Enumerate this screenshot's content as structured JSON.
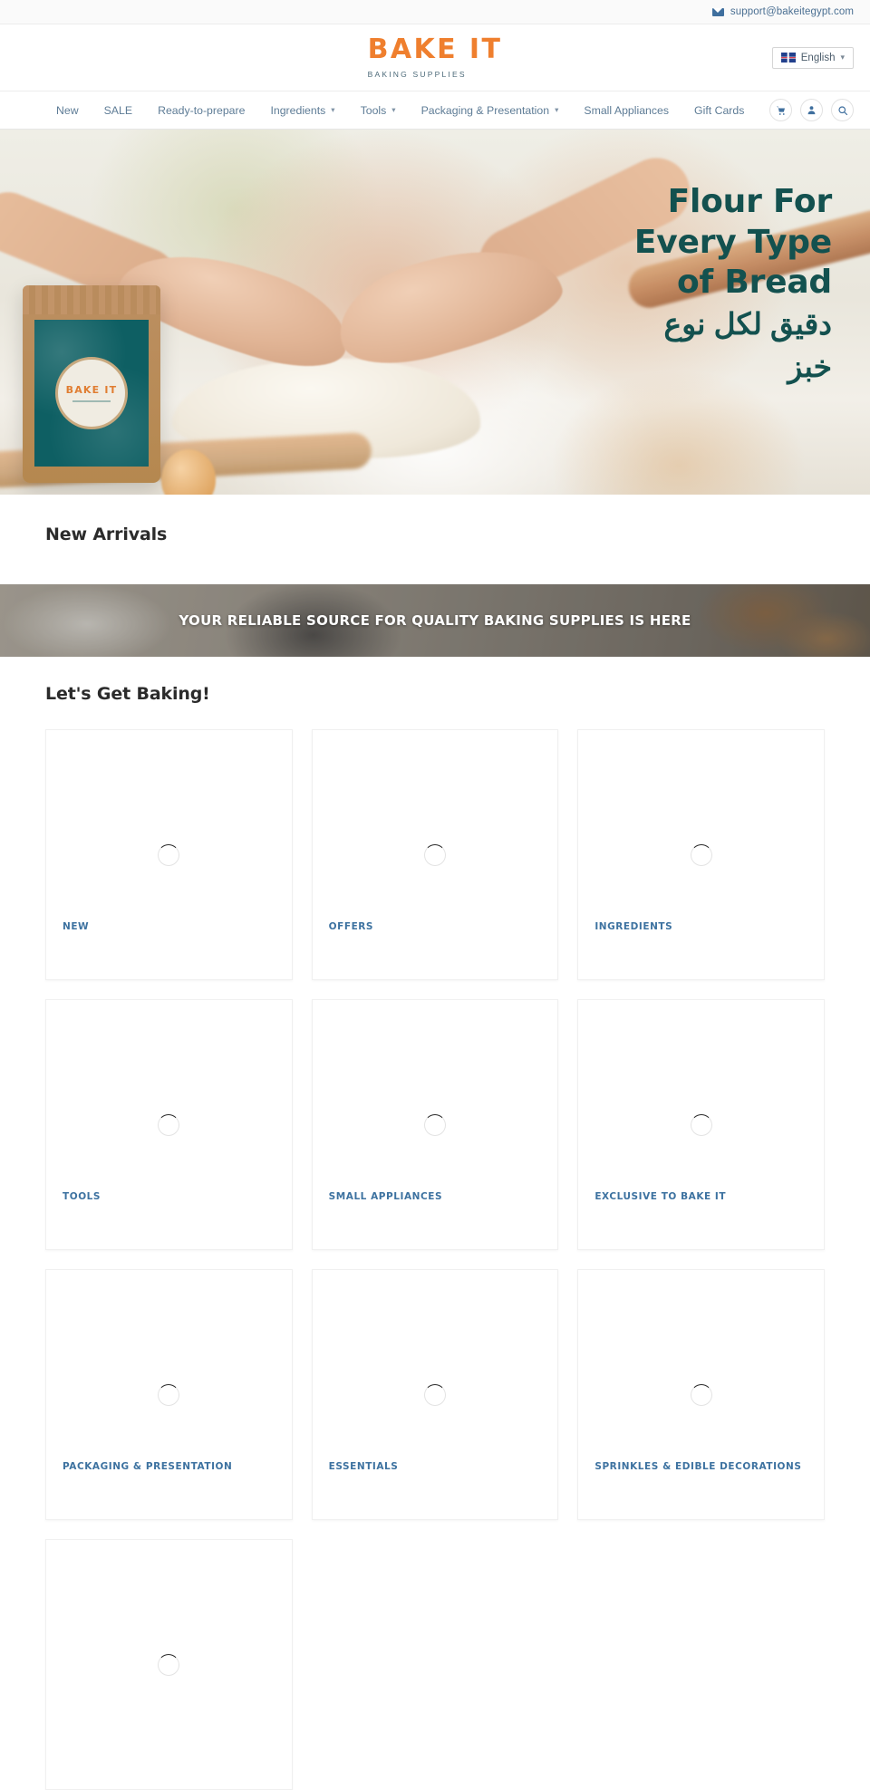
{
  "topbar": {
    "email": "support@bakeitegypt.com",
    "mail_icon": "envelope-icon"
  },
  "header": {
    "logo_main": "BAKE IT",
    "logo_sub": "BAKING SUPPLIES",
    "language": {
      "label": "English",
      "flag_icon": "uk-flag-icon",
      "caret_icon": "chevron-down-icon"
    }
  },
  "nav": {
    "items": [
      {
        "label": "New",
        "has_caret": false
      },
      {
        "label": "SALE",
        "has_caret": false
      },
      {
        "label": "Ready-to-prepare",
        "has_caret": false
      },
      {
        "label": "Ingredients",
        "has_caret": true
      },
      {
        "label": "Tools",
        "has_caret": true
      },
      {
        "label": "Packaging & Presentation",
        "has_caret": true
      },
      {
        "label": "Small Appliances",
        "has_caret": false
      },
      {
        "label": "Gift Cards",
        "has_caret": false
      }
    ],
    "caret": "⌄",
    "icons": [
      {
        "name": "cart-icon"
      },
      {
        "name": "account-icon"
      },
      {
        "name": "search-icon"
      }
    ]
  },
  "hero": {
    "line1": "Flour For",
    "line2": "Every Type",
    "line3": "of Bread",
    "arabic1": "دقيق لكل نوع",
    "arabic2": "خبز",
    "pouch_brand": "BAKE IT",
    "text_color": "#13514f"
  },
  "new_arrivals": {
    "title": "New Arrivals"
  },
  "promo": {
    "text": "YOUR RELIABLE SOURCE FOR QUALITY BAKING SUPPLIES IS HERE"
  },
  "baking": {
    "title": "Let's Get Baking!",
    "label_color": "#3d72a0",
    "cards": [
      {
        "label": "NEW"
      },
      {
        "label": "OFFERS"
      },
      {
        "label": "INGREDIENTS"
      },
      {
        "label": "TOOLS"
      },
      {
        "label": "SMALL APPLIANCES"
      },
      {
        "label": "EXCLUSIVE TO BAKE IT"
      },
      {
        "label": "PACKAGING & PRESENTATION"
      },
      {
        "label": "ESSENTIALS"
      },
      {
        "label": "SPRINKLES & EDIBLE DECORATIONS"
      },
      {
        "label": ""
      }
    ]
  }
}
